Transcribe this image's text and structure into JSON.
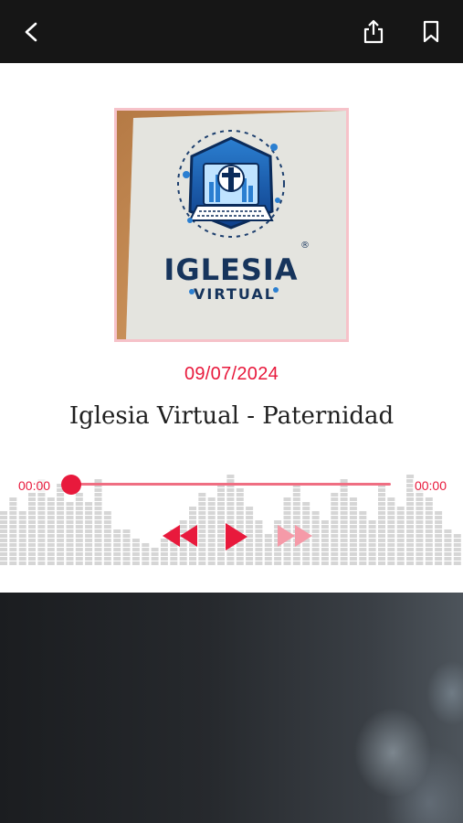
{
  "header": {
    "back_icon": "chevron-left-icon",
    "share_icon": "share-icon",
    "bookmark_icon": "bookmark-icon"
  },
  "artwork": {
    "logo_line1": "IGLESIA",
    "logo_line2": "VIRTUAL",
    "logo_mark": "®"
  },
  "episode": {
    "date": "09/07/2024",
    "title": "Iglesia Virtual - Paternidad"
  },
  "player": {
    "current_time": "00:00",
    "total_time": "00:00",
    "progress": 0,
    "rewind_icon": "rewind-icon",
    "play_icon": "play-icon",
    "forward_icon": "fast-forward-icon",
    "accent_color": "#e8193c"
  }
}
